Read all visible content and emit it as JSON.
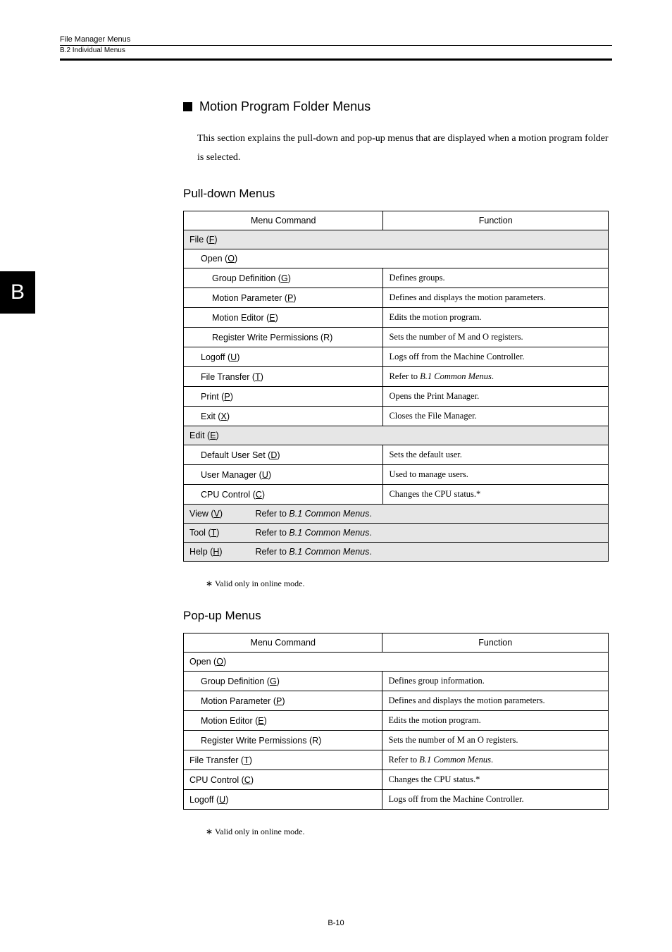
{
  "header": {
    "line1": "File Manager Menus",
    "line2": "B.2  Individual Menus"
  },
  "side_tab": "B",
  "section_title": "Motion Program Folder Menus",
  "intro_paragraph": "This section explains the pull-down and pop-up menus that are displayed when a motion program folder is selected.",
  "pulldown": {
    "heading": "Pull-down Menus",
    "col_cmd": "Menu Command",
    "col_func": "Function",
    "file_row": "File (",
    "file_key": "F",
    "file_close": ")",
    "open_row_pre": "Open (",
    "open_key": "O",
    "open_close": ")",
    "rows": [
      {
        "cmd_pre": "Group Definition (",
        "key": "G",
        "cmd_post": ")",
        "func": "Defines groups."
      },
      {
        "cmd_pre": "Motion Parameter (",
        "key": "P",
        "cmd_post": ")",
        "func": "Defines and displays the motion parameters."
      },
      {
        "cmd_pre": "Motion Editor (",
        "key": "E",
        "cmd_post": ")",
        "func": "Edits the motion program."
      },
      {
        "cmd": "Register Write Permissions (R)",
        "func": "Sets the number of M and O registers."
      }
    ],
    "after_open": [
      {
        "cmd_pre": "Logoff (",
        "key": "U",
        "cmd_post": ")",
        "func": "Logs off from the Machine Controller."
      },
      {
        "cmd_pre": "File Transfer (",
        "key": "T",
        "cmd_post": ")",
        "func_pre": "Refer to ",
        "func_it": "B.1 Common Menus",
        "func_post": "."
      },
      {
        "cmd_pre": "Print (",
        "key": "P",
        "cmd_post": ")",
        "func": "Opens the Print Manager."
      },
      {
        "cmd_pre": "Exit (",
        "key": "X",
        "cmd_post": ")",
        "func": "Closes the File Manager."
      }
    ],
    "edit_row_pre": "Edit (",
    "edit_key": "E",
    "edit_close": ")",
    "edit_rows": [
      {
        "cmd_pre": "Default User Set (",
        "key": "D",
        "cmd_post": ")",
        "func": "Sets the default user."
      },
      {
        "cmd_pre": "User Manager (",
        "key": "U",
        "cmd_post": ")",
        "func": "Used to manage users."
      },
      {
        "cmd_pre": "CPU Control (",
        "key": "C",
        "cmd_post": ")",
        "func": "Changes the CPU status.*"
      }
    ],
    "view_pre": "View (",
    "view_key": "V",
    "view_post": ")",
    "tool_pre": "Tool (",
    "tool_key": "T",
    "tool_post": ")",
    "help_pre": "Help (",
    "help_key": "H",
    "help_post": ")",
    "refer_pre": "Refer to ",
    "refer_it": "B.1 Common Menus",
    "refer_post": ".",
    "note": "∗  Valid only in online mode."
  },
  "popup": {
    "heading": "Pop-up Menus",
    "col_cmd": "Menu Command",
    "col_func": "Function",
    "open_row_pre": "Open (",
    "open_key": "O",
    "open_close": ")",
    "rows": [
      {
        "cmd_pre": "Group Definition (",
        "key": "G",
        "cmd_post": ")",
        "func": "Defines group information."
      },
      {
        "cmd_pre": "Motion Parameter (",
        "key": "P",
        "cmd_post": ")",
        "func": "Defines and displays the motion parameters."
      },
      {
        "cmd_pre": "Motion Editor (",
        "key": "E",
        "cmd_post": ")",
        "func": "Edits the motion program."
      },
      {
        "cmd": "Register Write Permissions (R)",
        "func": "Sets the number of M an O registers."
      }
    ],
    "after_open": [
      {
        "cmd_pre": "File Transfer (",
        "key": "T",
        "cmd_post": ")",
        "func_pre": "Refer to ",
        "func_it": "B.1 Common Menus",
        "func_post": "."
      },
      {
        "cmd_pre": "CPU Control (",
        "key": "C",
        "cmd_post": ")",
        "func": "Changes the CPU status.*"
      },
      {
        "cmd_pre": "Logoff (",
        "key": "U",
        "cmd_post": ")",
        "func": "Logs off from the Machine Controller."
      }
    ],
    "note": "∗  Valid only in online mode."
  },
  "page_number": "B-10"
}
